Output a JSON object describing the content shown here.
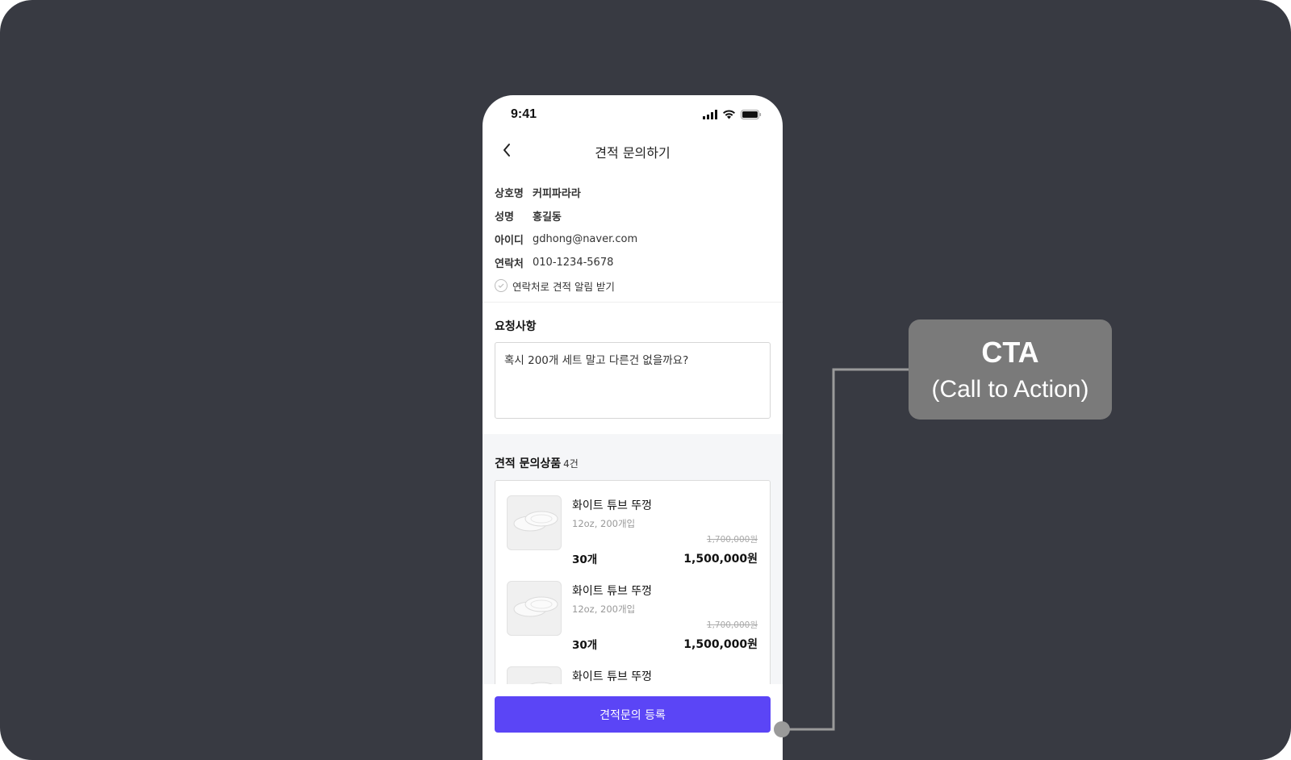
{
  "status_bar": {
    "time": "9:41"
  },
  "header": {
    "title": "견적 문의하기"
  },
  "info": {
    "rows": [
      {
        "label": "상호명",
        "value": "커피파라라"
      },
      {
        "label": "성명",
        "value": "홍길동"
      },
      {
        "label": "아이디",
        "value": "gdhong@naver.com"
      },
      {
        "label": "연락처",
        "value": "010-1234-5678"
      }
    ],
    "notify_label": "연락처로 견적 알림 받기"
  },
  "request": {
    "title": "요청사항",
    "text": "혹시 200개 세트 말고 다른건 없을까요?"
  },
  "items": {
    "title": "견적 문의상품",
    "count": "4건",
    "list": [
      {
        "name": "화이트 튜브 뚜껑",
        "option": "12oz, 200개입",
        "original_price": "1,700,000원",
        "qty": "30개",
        "price": "1,500,000원"
      },
      {
        "name": "화이트 튜브 뚜껑",
        "option": "12oz, 200개입",
        "original_price": "1,700,000원",
        "qty": "30개",
        "price": "1,500,000원"
      },
      {
        "name": "화이트 튜브 뚜껑"
      }
    ]
  },
  "cta": {
    "label": "견적문의 등록"
  },
  "annotation": {
    "title": "CTA",
    "subtitle": "(Call to Action)"
  },
  "colors": {
    "background": "#383a42",
    "cta": "#5b45f6",
    "callout": "#7a7a7a"
  }
}
